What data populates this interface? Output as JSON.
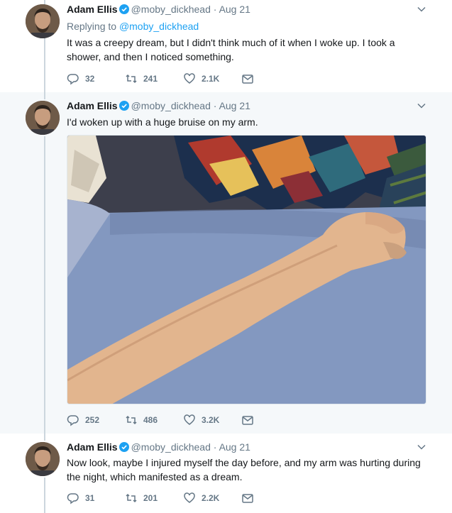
{
  "tweets": [
    {
      "author": "Adam Ellis",
      "handle": "@moby_dickhead",
      "separator": "·",
      "date": "Aug 21",
      "replying_prefix": "Replying to",
      "replying_handle": "@moby_dickhead",
      "text": "It was a creepy dream, but I didn't think much of it when I woke up. I took a shower, and then I noticed something.",
      "replies": "32",
      "retweets": "241",
      "likes": "2.1K"
    },
    {
      "author": "Adam Ellis",
      "handle": "@moby_dickhead",
      "separator": "·",
      "date": "Aug 21",
      "text": "I'd woken up with a huge bruise on my arm.",
      "replies": "252",
      "retweets": "486",
      "likes": "3.2K"
    },
    {
      "author": "Adam Ellis",
      "handle": "@moby_dickhead",
      "separator": "·",
      "date": "Aug 21",
      "text": "Now look, maybe I injured myself the day before, and my arm was hurting during the night, which manifested as a dream.",
      "replies": "31",
      "retweets": "201",
      "likes": "2.2K"
    }
  ],
  "colors": {
    "text_primary": "#14171a",
    "text_secondary": "#657786",
    "link": "#1da1f2",
    "verified": "#1da1f2",
    "thread_line": "#ccd6dd",
    "highlight_bg": "#f5f8fa"
  },
  "icons": {
    "reply": "reply-icon",
    "retweet": "retweet-icon",
    "like": "heart-icon",
    "message": "envelope-icon",
    "verified": "verified-badge-icon",
    "more": "chevron-down-icon"
  }
}
